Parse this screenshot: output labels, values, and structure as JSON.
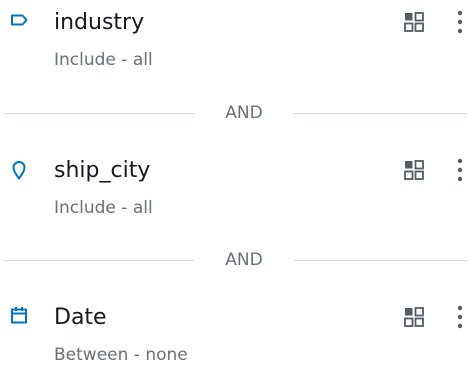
{
  "filters": [
    {
      "field": "industry",
      "description": "Include - all",
      "icon": "tag-icon",
      "icon_color": "#0073bb"
    },
    {
      "field": "ship_city",
      "description": "Include - all",
      "icon": "location-pin-icon",
      "icon_color": "#0073bb"
    },
    {
      "field": "Date",
      "description": "Between - none",
      "icon": "calendar-icon",
      "icon_color": "#0073bb"
    }
  ],
  "separators": [
    {
      "label": "AND"
    },
    {
      "label": "AND"
    }
  ],
  "colors": {
    "primary_text": "#16191f",
    "secondary_text": "#687078",
    "divider": "#d5dbdb",
    "icon_gray": "#545b64",
    "accent": "#0073bb"
  }
}
